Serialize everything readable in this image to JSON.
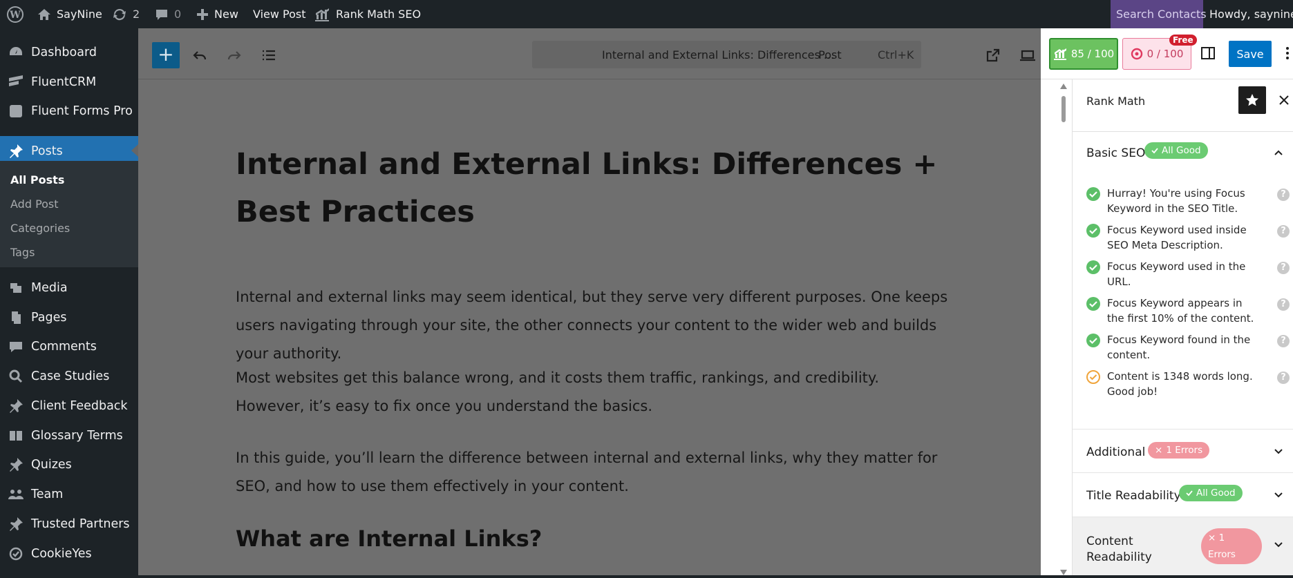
{
  "admin_bar": {
    "site_name": "SayNine",
    "updates_count": "2",
    "comments_count": "0",
    "new_label": "New",
    "view_post_label": "View Post",
    "rank_math_label": "Rank Math SEO",
    "search_contacts_label": "Search Contacts",
    "howdy_label": "Howdy, saynine"
  },
  "sidebar": {
    "items": [
      {
        "label": "Dashboard",
        "icon": "dashboard-icon"
      },
      {
        "label": "FluentCRM",
        "icon": "fluentcrm-icon"
      },
      {
        "label": "Fluent Forms Pro",
        "icon": "fluent-forms-icon"
      },
      {
        "label": "Posts",
        "icon": "pin-icon"
      },
      {
        "label": "Media",
        "icon": "media-icon"
      },
      {
        "label": "Pages",
        "icon": "pages-icon"
      },
      {
        "label": "Comments",
        "icon": "comments-icon"
      },
      {
        "label": "Case Studies",
        "icon": "search-icon"
      },
      {
        "label": "Client Feedback",
        "icon": "pin-icon"
      },
      {
        "label": "Glossary Terms",
        "icon": "glossary-icon"
      },
      {
        "label": "Quizes",
        "icon": "pin-icon"
      },
      {
        "label": "Team",
        "icon": "team-icon"
      },
      {
        "label": "Trusted Partners",
        "icon": "pin-icon"
      },
      {
        "label": "CookieYes",
        "icon": "cookie-icon"
      }
    ],
    "posts_sub": [
      "All Posts",
      "Add Post",
      "Categories",
      "Tags"
    ]
  },
  "editor": {
    "command_title": "Internal and External Links: Differences ...",
    "command_type": "· Post",
    "command_shortcut": "Ctrl+K",
    "title": "Internal and External Links: Differences + Best Practices",
    "paragraphs": [
      "Internal and external links may seem identical, but they serve very different purposes. One keeps users navigating through your site, the other connects your content to the wider web and builds your authority.",
      "Most websites get this balance wrong, and it costs them traffic, rankings, and credibility. However, it’s easy to fix once you understand the basics.",
      "In this guide, you’ll learn the difference between internal and external links, why they matter for SEO, and how to use them effectively in your content."
    ],
    "heading2": "What are Internal Links?"
  },
  "toolbar": {
    "seo_score": "85 / 100",
    "content_ai_score": "0 / 100",
    "free_badge": "Free",
    "save_label": "Save"
  },
  "rank_math": {
    "title": "Rank Math",
    "basic_seo": {
      "label": "Basic SEO",
      "badge": "All Good",
      "checks": [
        {
          "text": "Hurray! You're using Focus Keyword in the SEO Title.",
          "status": "pass"
        },
        {
          "text": "Focus Keyword used inside SEO Meta Description.",
          "status": "pass"
        },
        {
          "text": "Focus Keyword used in the URL.",
          "status": "pass"
        },
        {
          "text": "Focus Keyword appears in the first 10% of the content.",
          "status": "pass"
        },
        {
          "text": "Focus Keyword found in the content.",
          "status": "pass"
        },
        {
          "text": "Content is 1348 words long. Good job!",
          "status": "warning"
        }
      ]
    },
    "additional": {
      "label": "Additional",
      "badge": "1 Errors"
    },
    "title_readability": {
      "label": "Title Readability",
      "badge": "All Good"
    },
    "content_readability": {
      "label_line1": "Content",
      "label_line2": "Readability",
      "badge_line1": "1",
      "badge_line2": "Errors"
    }
  },
  "colors": {
    "wp_blue": "#2271b1",
    "good_green": "#6bcb72",
    "error_red": "#f1979f",
    "save_blue": "#0073c4"
  }
}
